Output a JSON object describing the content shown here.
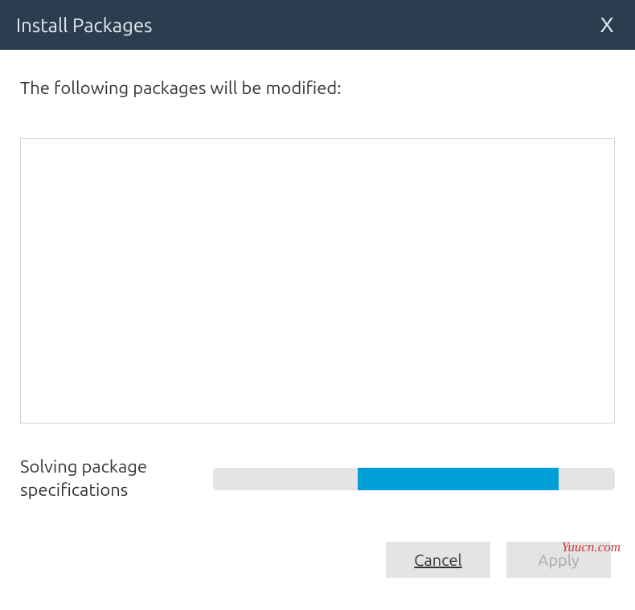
{
  "titlebar": {
    "title": "Install Packages",
    "close_label": "X"
  },
  "main": {
    "heading": "The following packages will be modified:",
    "packages": []
  },
  "progress": {
    "label": "Solving package specifications",
    "fill_left_pct": 36,
    "fill_width_pct": 50
  },
  "buttons": {
    "cancel": "Cancel",
    "apply": "Apply"
  },
  "watermark": "Yuucn.com"
}
